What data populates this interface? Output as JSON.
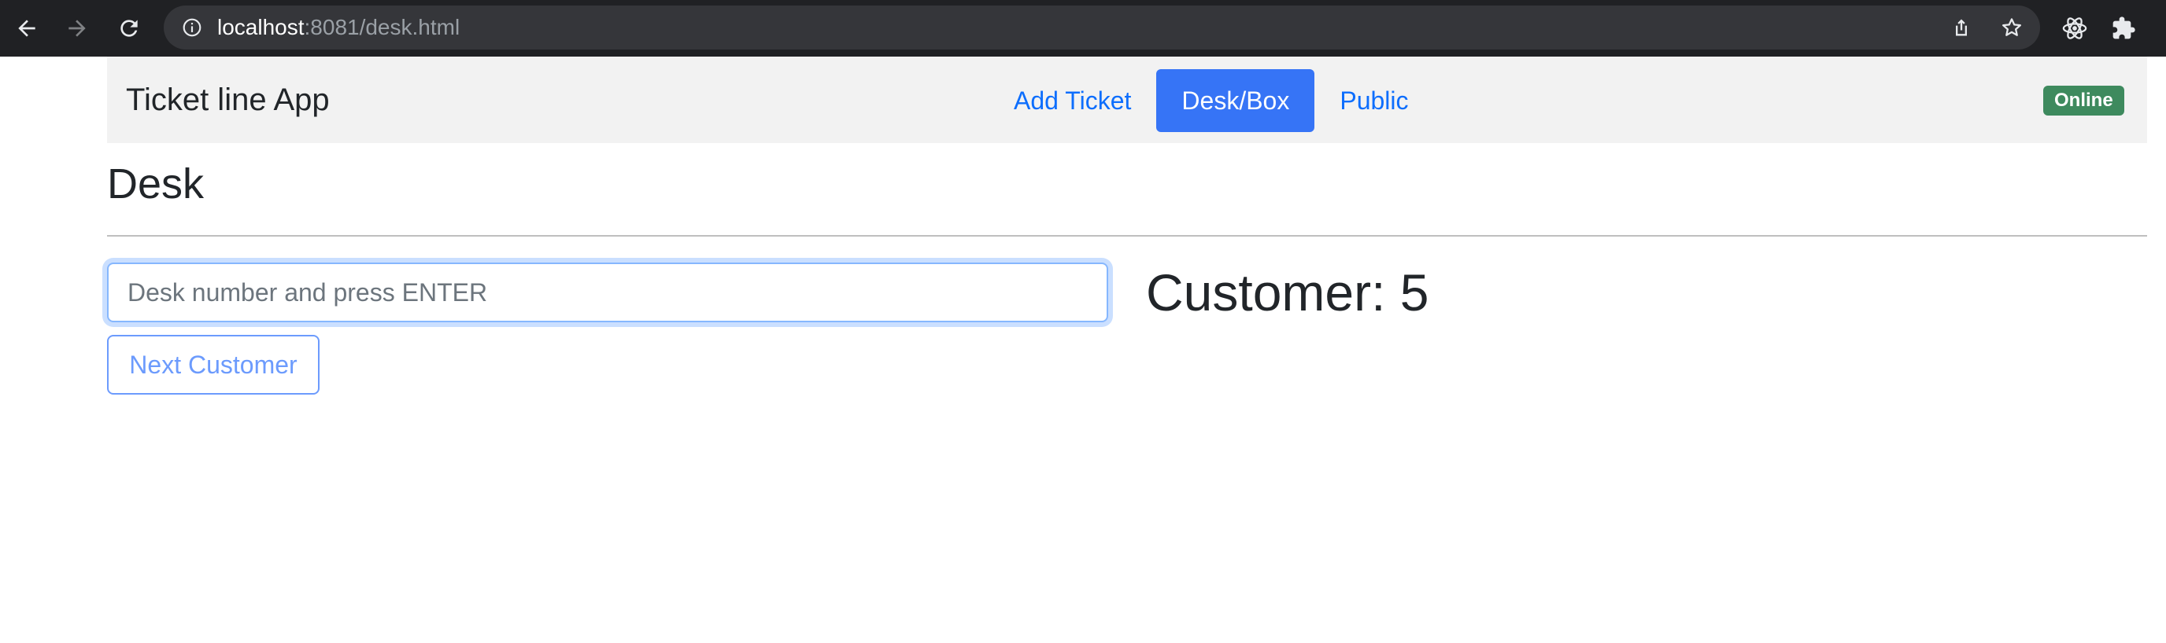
{
  "browser": {
    "url_host": "localhost",
    "url_rest": ":8081/desk.html"
  },
  "navbar": {
    "brand": "Ticket line App",
    "links": [
      {
        "label": "Add Ticket",
        "active": false
      },
      {
        "label": "Desk/Box",
        "active": true
      },
      {
        "label": "Public",
        "active": false
      }
    ],
    "status_badge": "Online"
  },
  "page": {
    "title": "Desk"
  },
  "desk_form": {
    "input_value": "",
    "input_placeholder": "Desk number and press ENTER",
    "next_button_label": "Next Customer"
  },
  "customer": {
    "label": "Customer: 5"
  },
  "icons": {
    "back": "arrow-left-icon",
    "forward": "arrow-right-icon",
    "reload": "reload-icon",
    "site_info": "info-icon",
    "share": "share-icon",
    "bookmark": "star-icon",
    "react_devtools": "react-icon",
    "extensions": "puzzle-icon"
  },
  "colors": {
    "primary": "#0d6efd",
    "active_nav": "#3674f6",
    "badge_success": "#3e8a5e",
    "chrome_bg": "#202124"
  }
}
